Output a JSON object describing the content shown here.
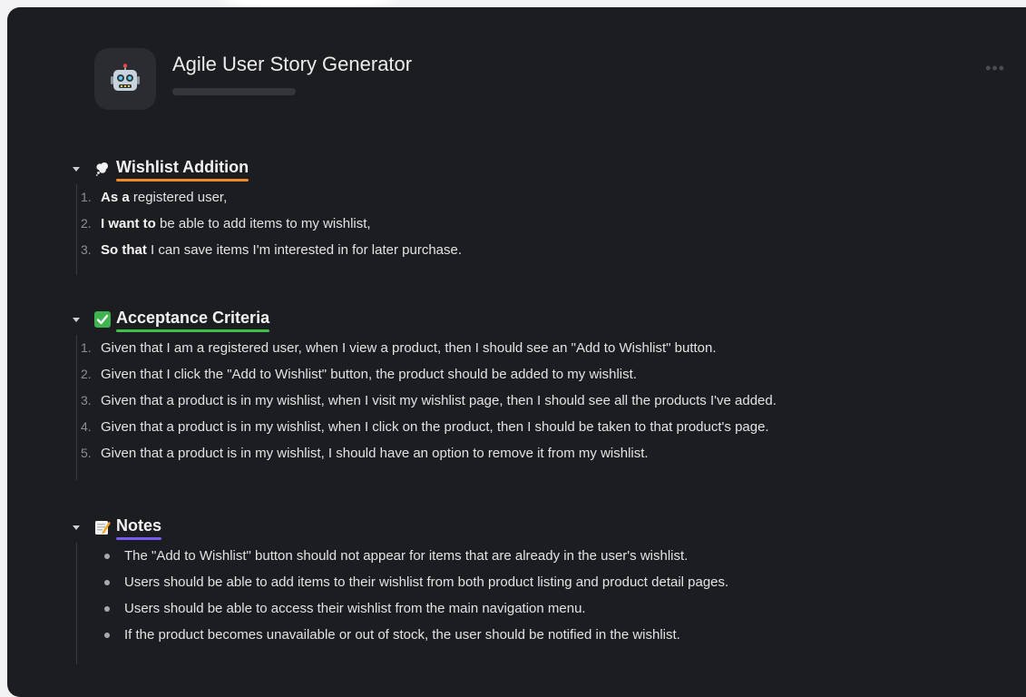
{
  "header": {
    "title": "Agile User Story Generator",
    "more_label": "•••"
  },
  "icons": {
    "app": "robot-icon",
    "section1": "thought-bubble-icon",
    "section2": "check-mark-icon",
    "section3": "memo-icon"
  },
  "colors": {
    "section1_underline": "#f08a24",
    "section2_underline": "#3fbf4a",
    "section3_underline": "#7b5cf0"
  },
  "wishlist": {
    "title": "Wishlist Addition",
    "items": [
      {
        "num": "1.",
        "bold": "As a",
        "rest": " registered user,"
      },
      {
        "num": "2.",
        "bold": "I want to",
        "rest": " be able to add items to my wishlist,"
      },
      {
        "num": "3.",
        "bold": "So that",
        "rest": " I can save items I'm interested in for later purchase."
      }
    ]
  },
  "acceptance": {
    "title": "Acceptance Criteria",
    "items": [
      {
        "num": "1.",
        "text": "Given that I am a registered user, when I view a product, then I should see an \"Add to Wishlist\" button."
      },
      {
        "num": "2.",
        "text": "Given that I click the \"Add to Wishlist\" button, the product should be added to my wishlist."
      },
      {
        "num": "3.",
        "text": "Given that a product is in my wishlist, when I visit my wishlist page, then I should see all the products I've added."
      },
      {
        "num": "4.",
        "text": "Given that a product is in my wishlist, when I click on the product, then I should be taken to that product's page."
      },
      {
        "num": "5.",
        "text": "Given that a product is in my wishlist, I should have an option to remove it from my wishlist."
      }
    ]
  },
  "notes": {
    "title": "Notes",
    "items": [
      "The \"Add to Wishlist\" button should not appear for items that are already in the user's wishlist.",
      "Users should be able to add items to their wishlist from both product listing and product detail pages.",
      "Users should be able to access their wishlist from the main navigation menu.",
      "If the product becomes unavailable or out of stock, the user should be notified in the wishlist."
    ]
  }
}
